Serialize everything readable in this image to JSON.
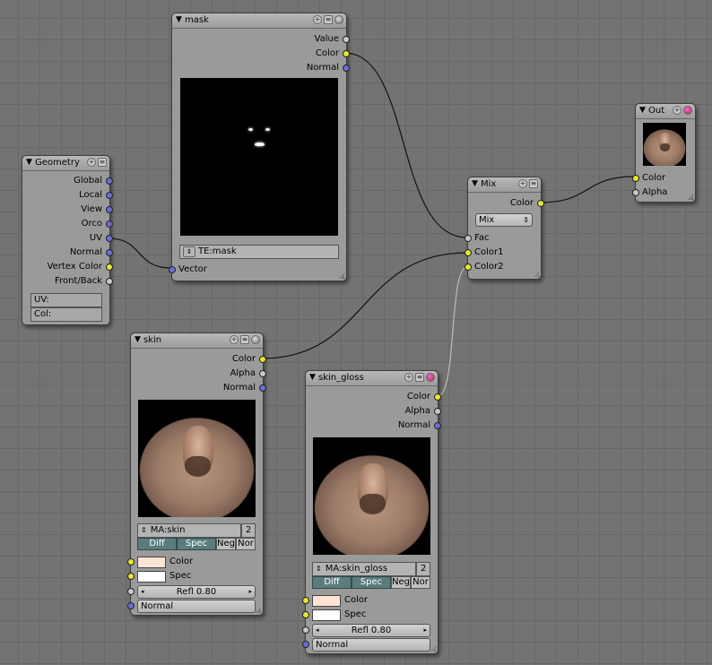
{
  "nodes": {
    "mask": {
      "title": "mask",
      "outputs": [
        "Value",
        "Color",
        "Normal"
      ],
      "texture_select": "TE:mask",
      "input": "Vector"
    },
    "geometry": {
      "title": "Geometry",
      "outputs": [
        "Global",
        "Local",
        "View",
        "Orco",
        "UV",
        "Normal",
        "Vertex Color",
        "Front/Back"
      ],
      "uv_field": "UV:",
      "col_field": "Col:"
    },
    "mix": {
      "title": "Mix",
      "output": "Color",
      "blend_mode": "Mix",
      "inputs": [
        "Fac",
        "Color1",
        "Color2"
      ]
    },
    "out": {
      "title": "Out",
      "inputs": [
        "Color",
        "Alpha"
      ]
    },
    "skin": {
      "title": "skin",
      "outputs": [
        "Color",
        "Alpha",
        "Normal"
      ],
      "material": "MA:skin",
      "users": "2",
      "toggles": [
        "Diff",
        "Spec",
        "Neg",
        "Nor"
      ],
      "inputs": [
        "Color",
        "Spec"
      ],
      "refl": "Refl 0.80",
      "normal": "Normal",
      "colors": {
        "color": "#fde4d4",
        "spec": "#ffffff"
      }
    },
    "skin_gloss": {
      "title": "skin_gloss",
      "outputs": [
        "Color",
        "Alpha",
        "Normal"
      ],
      "material": "MA:skin_gloss",
      "users": "2",
      "toggles": [
        "Diff",
        "Spec",
        "Neg",
        "Nor"
      ],
      "inputs": [
        "Color",
        "Spec"
      ],
      "refl": "Refl 0.80",
      "normal": "Normal",
      "colors": {
        "color": "#fde4d4",
        "spec": "#ffffff"
      }
    }
  },
  "colors": {
    "background": "#737373",
    "node": "#9a9a9a",
    "socket_color": "#e6e62e",
    "socket_vector": "#6c6cd8",
    "socket_value": "#c8c8c8",
    "toggle_active": "#5c7c7c"
  }
}
